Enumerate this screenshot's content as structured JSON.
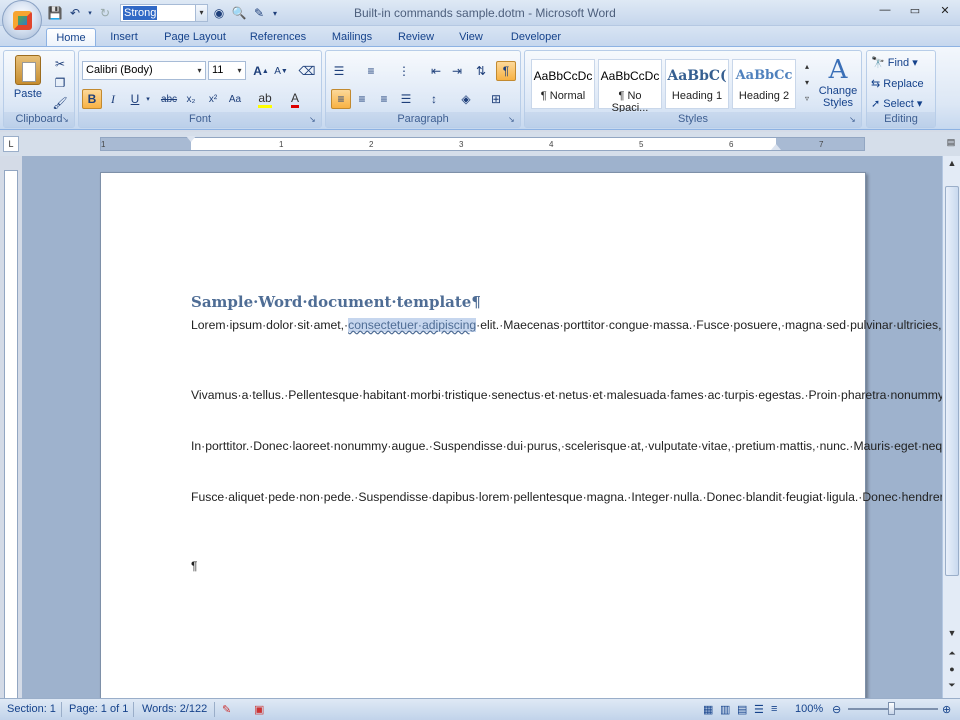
{
  "window": {
    "title": "Built-in commands sample.dotm - Microsoft Word"
  },
  "qat": {
    "style_value": "Strong"
  },
  "tabs": [
    "Home",
    "Insert",
    "Page Layout",
    "References",
    "Mailings",
    "Review",
    "View",
    "Developer"
  ],
  "ribbon": {
    "clipboard": {
      "paste_label": "Paste",
      "group_label": "Clipboard"
    },
    "font": {
      "font_name": "Calibri (Body)",
      "font_size": "11",
      "group_label": "Font"
    },
    "paragraph": {
      "group_label": "Paragraph"
    },
    "styles": {
      "group_label": "Styles",
      "items": [
        {
          "preview": "AaBbCcDc",
          "name": "¶ Normal"
        },
        {
          "preview": "AaBbCcDc",
          "name": "¶ No Spaci..."
        },
        {
          "preview": "AaBbC(",
          "name": "Heading 1"
        },
        {
          "preview": "AaBbCc",
          "name": "Heading 2"
        }
      ],
      "change_styles_label": "Change Styles"
    },
    "editing": {
      "group_label": "Editing",
      "find": "Find",
      "replace": "Replace",
      "select": "Select"
    }
  },
  "ruler": {
    "numbers": [
      "1",
      "1",
      "2",
      "3",
      "4",
      "5",
      "6",
      "7"
    ]
  },
  "document": {
    "title": "Sample·Word·document·template¶",
    "paragraphs": [
      {
        "before": "Lorem·ipsum·dolor·sit·amet,·",
        "highlight": "consectetuer·adipiscing",
        "after": "·elit.·Maecenas·porttitor·congue·massa.·Fusce·posuere,·magna·sed·pulvinar·ultricies,·purus·lectus·malesuada·libero,·sit·amet·commodo·magna·eros·quis·urna.·Nunc·viverra·imperdiet·enim.·Fusce·est.¶"
      },
      {
        "before": "Vivamus·a·tellus.·Pellentesque·habitant·morbi·tristique·senectus·et·netus·et·malesuada·fames·ac·turpis·egestas.·Proin·pharetra·nonummy·pede.·Mauris·et·orci.·Aenean·nec·lorem.¶",
        "highlight": "",
        "after": ""
      },
      {
        "before": "In·porttitor.·Donec·laoreet·nonummy·augue.·Suspendisse·dui·purus,·scelerisque·at,·vulputate·vitae,·pretium·mattis,·nunc.·Mauris·eget·neque·at·sem·venenatis·eleifend.·Ut·nonummy.¶",
        "highlight": "",
        "after": ""
      },
      {
        "before": "Fusce·aliquet·pede·non·pede.·Suspendisse·dapibus·lorem·pellentesque·magna.·Integer·nulla.·Donec·blandit·feugiat·ligula.·Donec·hendrerit,·felis·et·imperdiet·euismod,·purus·ipsum·pretium·metus,·in·lacinia·nulla·nisl·eget·sapien.¶",
        "highlight": "",
        "after": ""
      }
    ],
    "last_mark": "¶"
  },
  "status": {
    "section": "Section: 1",
    "page": "Page: 1 of 1",
    "words": "Words: 2/122",
    "zoom": "100%"
  },
  "colors": {
    "accent": "#15428b",
    "heading": "#4f6d95",
    "selection": "#c6d6ee"
  }
}
